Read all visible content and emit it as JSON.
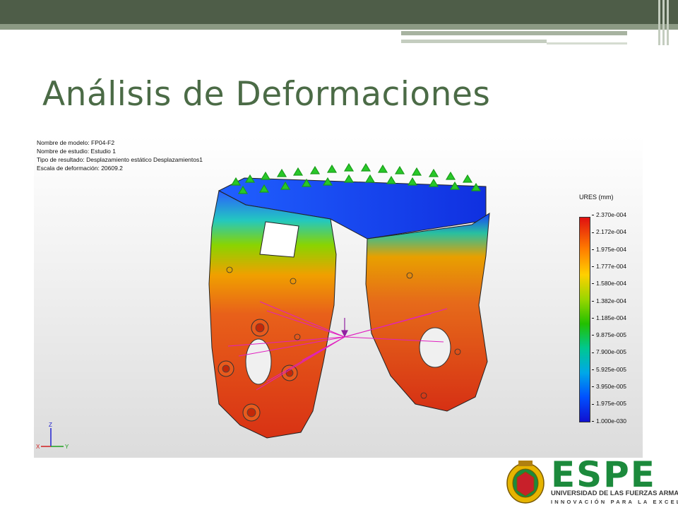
{
  "slide": {
    "title": "Análisis de Deformaciones"
  },
  "viewport": {
    "model_info": {
      "model_name": "Nombre de modelo: FP04-F2",
      "study_name": "Nombre de estudio: Estudio 1",
      "result_type": "Tipo de resultado: Desplazamiento estático Desplazamientos1",
      "deformation_scale": "Escala de deformación: 20609.2"
    },
    "legend": {
      "title": "URES (mm)",
      "labels": [
        "2.370e-004",
        "2.172e-004",
        "1.975e-004",
        "1.777e-004",
        "1.580e-004",
        "1.382e-004",
        "1.185e-004",
        "9.875e-005",
        "7.900e-005",
        "5.925e-005",
        "3.950e-005",
        "1.975e-005",
        "1.000e-030"
      ]
    },
    "triad": {
      "x_label": "X",
      "y_label": "Y",
      "z_label": "Z"
    }
  },
  "logo": {
    "name": "ESPE",
    "line1": "UNIVERSIDAD DE LAS FUERZAS ARMADAS",
    "line2": "INNOVACIÓN PARA LA EXCELENCIA"
  },
  "colors": {
    "header_bar": "#4e5d48",
    "title": "#4b6b46",
    "brand_green": "#1c8a3c"
  }
}
